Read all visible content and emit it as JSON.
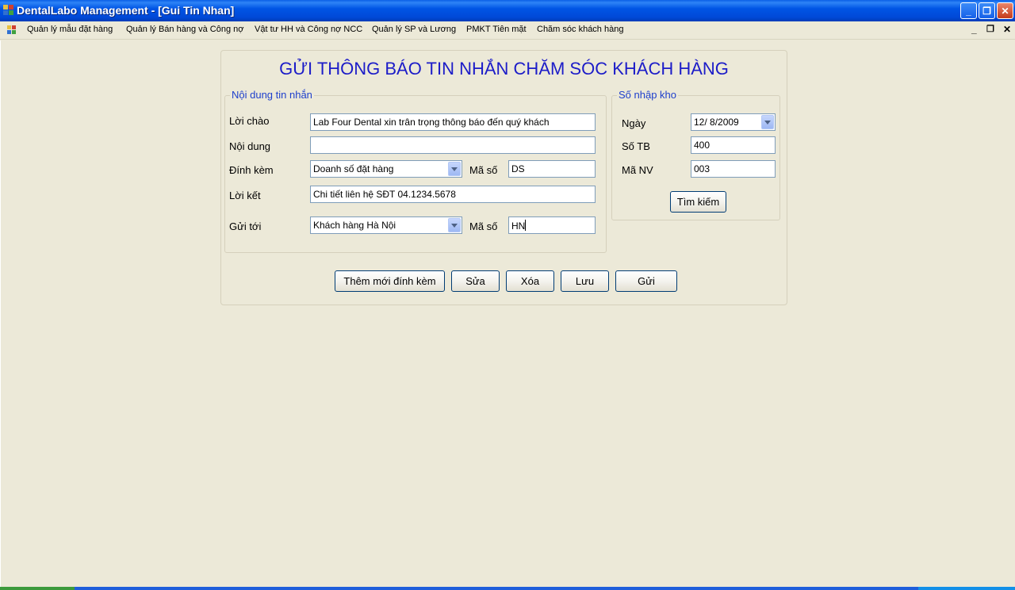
{
  "window": {
    "title": "DentalLabo Management - [Gui Tin Nhan]",
    "minimize": "_",
    "maximize": "❐",
    "close": "✕"
  },
  "menu": {
    "items": [
      "Quản lý mẫu đặt hàng",
      "Quản lý Bán hàng và Công nợ",
      "Vật tư HH và Công nợ NCC",
      "Quản lý SP và Lương",
      "PMKT Tiên mặt",
      "Chăm sóc khách hàng"
    ],
    "mdi_minimize": "_",
    "mdi_restore": "❐",
    "mdi_close": "✕"
  },
  "form": {
    "title": "GỬI THÔNG BÁO TIN NHẮN CHĂM SÓC KHÁCH HÀNG"
  },
  "message_group": {
    "legend": "Nội dung tin nhắn",
    "greeting_label": "Lời chào",
    "greeting_value": "Lab Four Dental xin trân trọng thông báo đến quý khách",
    "content_label": "Nội dung",
    "content_value": "",
    "attach_label": "Đính kèm",
    "attach_value": "Doanh số đặt hàng",
    "attach_code_label": "Mã số",
    "attach_code_value": "DS",
    "closing_label": "Lời kết",
    "closing_value": "Chi tiết liên hệ SĐT 04.1234.5678",
    "send_to_label": "Gửi tới",
    "send_to_value": "Khách hàng Hà Nội",
    "send_code_label": "Mã số",
    "send_code_value": "HN"
  },
  "stock_group": {
    "legend": "Số nhập kho",
    "date_label": "Ngày",
    "date_value": "12/  8/2009",
    "tb_label": "Số TB",
    "tb_value": "400",
    "nv_label": "Mã NV",
    "nv_value": "003",
    "search_button": "Tìm kiếm"
  },
  "actions": {
    "add_attachment": "Thêm mới đính kèm",
    "edit": "Sửa",
    "delete": "Xóa",
    "save": "Lưu",
    "send": "Gửi"
  },
  "colors": {
    "titlebar": "#0055E5",
    "form_title": "#1C1CC8",
    "legend": "#1E3FCC",
    "background": "#ECE9D8"
  }
}
